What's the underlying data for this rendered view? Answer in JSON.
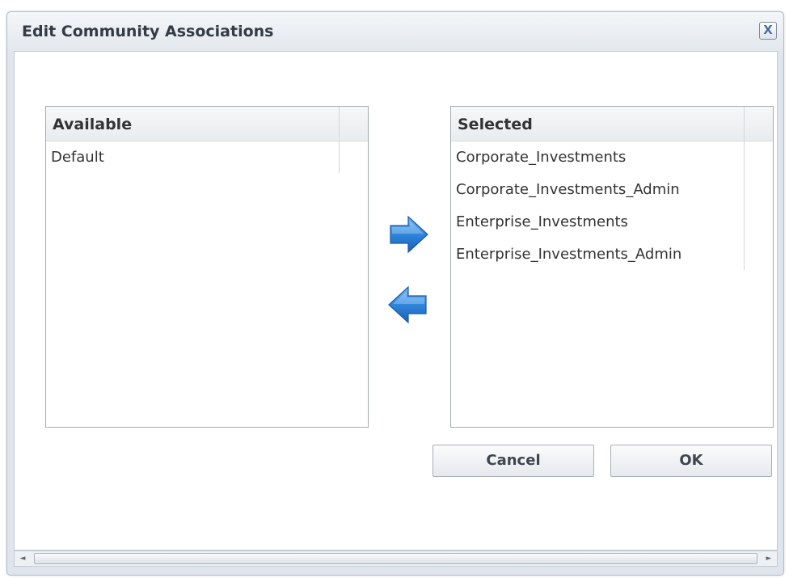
{
  "dialog": {
    "title": "Edit Community Associations",
    "close_glyph": "X"
  },
  "available": {
    "header": "Available",
    "items": [
      "Default"
    ]
  },
  "selected": {
    "header": "Selected",
    "items": [
      "Corporate_Investments",
      "Corporate_Investments_Admin",
      "Enterprise_Investments",
      "Enterprise_Investments_Admin"
    ]
  },
  "arrows": {
    "add_icon": "arrow-right-icon",
    "remove_icon": "arrow-left-icon",
    "color": "#2e7fd6"
  },
  "buttons": {
    "cancel": "Cancel",
    "ok": "OK"
  },
  "scrollbar": {
    "left_glyph": "◄",
    "right_glyph": "►"
  }
}
